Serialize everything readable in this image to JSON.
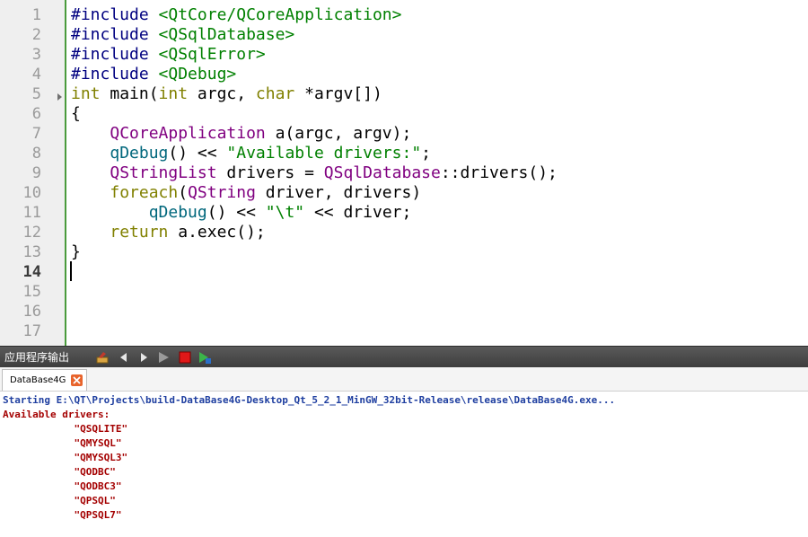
{
  "editor": {
    "current_line": 14,
    "line_numbers": [
      "1",
      "2",
      "3",
      "4",
      "5",
      "6",
      "7",
      "8",
      "9",
      "10",
      "11",
      "12",
      "13",
      "14",
      "15",
      "16",
      "17"
    ],
    "lines": [
      [
        {
          "t": "#include ",
          "c": "pp"
        },
        {
          "t": "<QtCore/QCoreApplication>",
          "c": "inc"
        }
      ],
      [
        {
          "t": "#include ",
          "c": "pp"
        },
        {
          "t": "<QSqlDatabase>",
          "c": "inc"
        }
      ],
      [
        {
          "t": "#include ",
          "c": "pp"
        },
        {
          "t": "<QSqlError>",
          "c": "inc"
        }
      ],
      [
        {
          "t": "#include ",
          "c": "pp"
        },
        {
          "t": "<QDebug>",
          "c": "inc"
        }
      ],
      [
        {
          "t": "int",
          "c": "kw"
        },
        {
          "t": " main("
        },
        {
          "t": "int",
          "c": "kw"
        },
        {
          "t": " argc, "
        },
        {
          "t": "char",
          "c": "kw"
        },
        {
          "t": " *argv[])"
        }
      ],
      [
        {
          "t": "{"
        }
      ],
      [
        {
          "t": "    "
        },
        {
          "t": "QCoreApplication",
          "c": "ty"
        },
        {
          "t": " a(argc, argv);"
        }
      ],
      [
        {
          "t": "    "
        },
        {
          "t": "qDebug",
          "c": "fn"
        },
        {
          "t": "() << "
        },
        {
          "t": "\"Available drivers:\"",
          "c": "st"
        },
        {
          "t": ";"
        }
      ],
      [
        {
          "t": "    "
        },
        {
          "t": "QStringList",
          "c": "ty"
        },
        {
          "t": " drivers = "
        },
        {
          "t": "QSqlDatabase",
          "c": "ty"
        },
        {
          "t": "::drivers();"
        }
      ],
      [
        {
          "t": "    "
        },
        {
          "t": "foreach",
          "c": "kw"
        },
        {
          "t": "("
        },
        {
          "t": "QString",
          "c": "ty"
        },
        {
          "t": " driver, drivers)"
        }
      ],
      [
        {
          "t": "        "
        },
        {
          "t": "qDebug",
          "c": "fn"
        },
        {
          "t": "() << "
        },
        {
          "t": "\"\\t\"",
          "c": "st"
        },
        {
          "t": " << driver;"
        }
      ],
      [
        {
          "t": "    "
        },
        {
          "t": "return",
          "c": "kw"
        },
        {
          "t": " a.exec();"
        }
      ],
      [
        {
          "t": "}"
        }
      ],
      [],
      [],
      [],
      []
    ]
  },
  "output_pane": {
    "title": "应用程序输出",
    "toolbar_icons": [
      "build-icon",
      "prev-arrow-icon",
      "next-arrow-icon",
      "run-icon",
      "stop-icon",
      "debug-run-icon"
    ],
    "tab": {
      "label": "DataBase4G",
      "close_icon": "close-icon"
    },
    "log": [
      {
        "text": "Starting E:\\QT\\Projects\\build-DataBase4G-Desktop_Qt_5_2_1_MinGW_32bit-Release\\release\\DataBase4G.exe...",
        "kind": "info"
      },
      {
        "text": "Available drivers:",
        "kind": "err"
      },
      {
        "text": "            \"QSQLITE\"",
        "kind": "err"
      },
      {
        "text": "            \"QMYSQL\"",
        "kind": "err"
      },
      {
        "text": "            \"QMYSQL3\"",
        "kind": "err"
      },
      {
        "text": "            \"QODBC\"",
        "kind": "err"
      },
      {
        "text": "            \"QODBC3\"",
        "kind": "err"
      },
      {
        "text": "            \"QPSQL\"",
        "kind": "err"
      },
      {
        "text": "            \"QPSQL7\"",
        "kind": "err"
      }
    ]
  },
  "colors": {
    "gutter_border": "#4a9b3c",
    "keyword": "#808000",
    "type": "#800080",
    "string": "#008000",
    "log_info": "#1f3fa0",
    "log_error": "#a40000"
  }
}
